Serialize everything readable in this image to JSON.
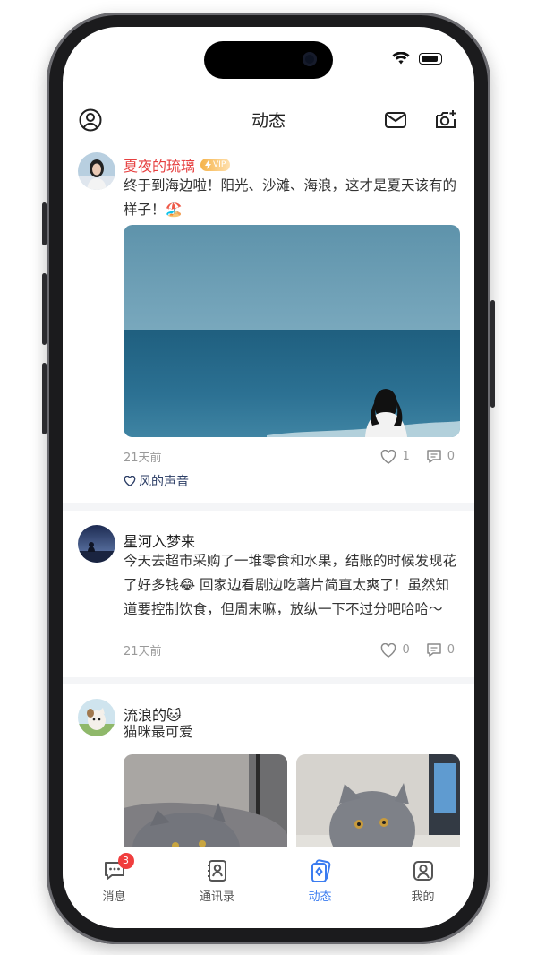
{
  "header": {
    "title": "动态"
  },
  "posts": [
    {
      "name": "夏夜的琉璃",
      "vip": "VIP",
      "text": "终于到海边啦！阳光、沙滩、海浪，这才是夏天该有的样子！🏖️",
      "time": "21天前",
      "likes": "1",
      "comments": "0",
      "liked_by": "风的声音"
    },
    {
      "name": "星河入梦来",
      "text": "今天去超市采购了一堆零食和水果，结账的时候发现花了好多钱😂 回家边看剧边吃薯片简直太爽了！虽然知道要控制饮食，但周末嘛，放纵一下不过分吧哈哈～",
      "time": "21天前",
      "likes": "0",
      "comments": "0"
    },
    {
      "name": "流浪的🐱",
      "text": "猫咪最可爱"
    }
  ],
  "tabbar": {
    "messages": {
      "label": "消息",
      "badge": "3"
    },
    "contacts": {
      "label": "通讯录"
    },
    "moments": {
      "label": "动态"
    },
    "me": {
      "label": "我的"
    }
  },
  "colors": {
    "accent": "#3b7cf0",
    "name_vip": "#e64040",
    "badge": "#f03e3e"
  }
}
